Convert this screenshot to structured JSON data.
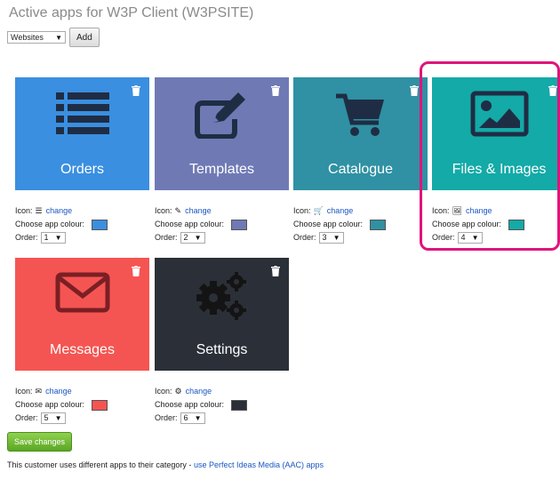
{
  "header": {
    "title": "Active apps for W3P Client (W3PSITE)"
  },
  "toolbar": {
    "category_value": "Websites",
    "add_label": "Add"
  },
  "labels": {
    "icon": "Icon:",
    "change": "change",
    "choose_colour": "Choose app colour:",
    "order": "Order:"
  },
  "apps": [
    {
      "name": "Orders",
      "icon": "list-icon",
      "color": "#3a8fe0",
      "order": "1"
    },
    {
      "name": "Templates",
      "icon": "edit-icon",
      "color": "#6f7ab5",
      "order": "2"
    },
    {
      "name": "Catalogue",
      "icon": "cart-icon",
      "color": "#2f91a3",
      "order": "3"
    },
    {
      "name": "Files & Images",
      "icon": "image-icon",
      "color": "#13aaa7",
      "order": "4"
    },
    {
      "name": "Messages",
      "icon": "envelope-icon",
      "color": "#f55552",
      "order": "5"
    },
    {
      "name": "Settings",
      "icon": "cogs-icon",
      "color": "#2b3038",
      "order": "6"
    }
  ],
  "actions": {
    "save_label": "Save changes"
  },
  "footer": {
    "text": "This customer uses different apps to their category - ",
    "link": "use Perfect Ideas Media (AAC) apps"
  }
}
